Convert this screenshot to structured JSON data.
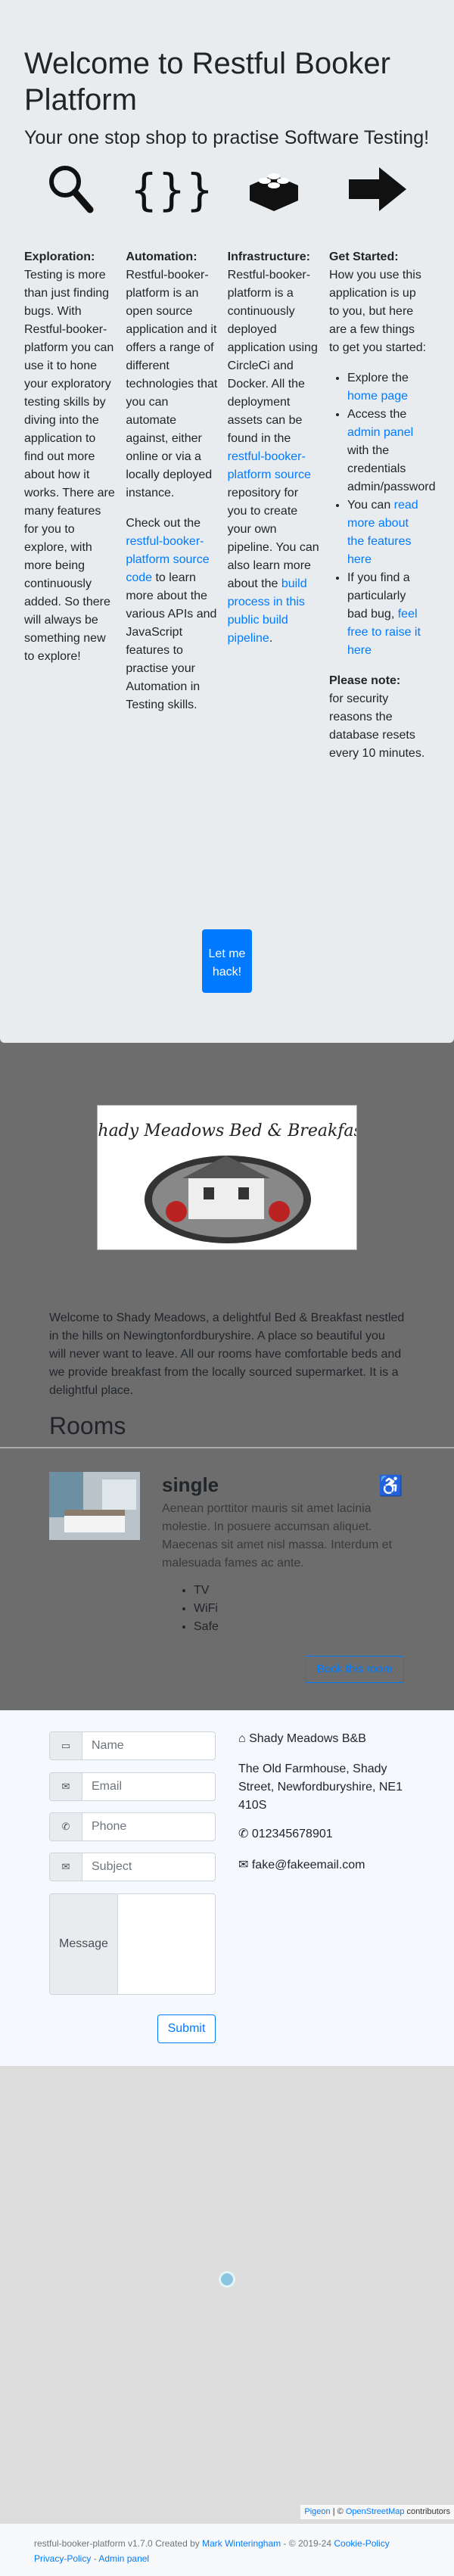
{
  "jumbotron": {
    "title": "Welcome to Restful Booker Platform",
    "lead": "Your one stop shop to practise Software Testing!",
    "exploration": {
      "heading": "Exploration:",
      "text": "Testing is more than just finding bugs. With Restful-booker-platform you can use it to hone your exploratory testing skills by diving into the application to find out more about how it works. There are many features for you to explore, with more being continuously added. So there will always be something new to explore!"
    },
    "automation": {
      "heading": "Automation:",
      "text": "Restful-booker-platform is an open source application and it offers a range of different technologies that you can automate against, either online or via a locally deployed instance.",
      "text2_pre": "Check out the ",
      "link": "restful-booker-platform source code",
      "text2_post": " to learn more about the various APIs and JavaScript features to practise your Automation in Testing skills."
    },
    "infrastructure": {
      "heading": "Infrastructure:",
      "text_pre": "Restful-booker-platform is a continuously deployed application using CircleCi and Docker. All the deployment assets can be found in the ",
      "link1": "restful-booker-platform source",
      "text_mid": " repository for you to create your own pipeline. You can also learn more about the ",
      "link2": "build process in this public build pipeline",
      "text_post": "."
    },
    "started": {
      "heading": "Get Started:",
      "text": "How you use this application is up to you, but here are a few things to get you started:",
      "li1_pre": "Explore the ",
      "li1_link": "home page",
      "li2_pre": "Access the ",
      "li2_link": "admin panel",
      "li2_post": " with the credentials admin/password",
      "li3_pre": "You can ",
      "li3_link": "read more about the features here",
      "li4_pre": "If you find a particularly bad bug, ",
      "li4_link": "feel free to raise it here",
      "note_heading": "Please note:",
      "note_text": "for security reasons the database resets every 10 minutes."
    },
    "hack_button": "Let me hack!"
  },
  "hotel": {
    "logo_text": "Shady Meadows Bed & Breakfast",
    "welcome": "Welcome to Shady Meadows, a delightful Bed & Breakfast nestled in the hills on Newingtonfordburyshire. A place so beautiful you will never want to leave. All our rooms have comfortable beds and we provide breakfast from the locally sourced supermarket. It is a delightful place."
  },
  "rooms": {
    "heading": "Rooms",
    "room": {
      "type": "single",
      "description": "Aenean porttitor mauris sit amet lacinia molestie. In posuere accumsan aliquet. Maecenas sit amet nisl massa. Interdum et malesuada fames ac ante.",
      "features": [
        "TV",
        "WiFi",
        "Safe"
      ],
      "book_button": "Book this room"
    }
  },
  "contact": {
    "name_placeholder": "Name",
    "email_placeholder": "Email",
    "phone_placeholder": "Phone",
    "subject_placeholder": "Subject",
    "message_label": "Message",
    "submit": "Submit",
    "business_name": "Shady Meadows B&B",
    "address": "The Old Farmhouse, Shady Street, Newfordburyshire, NE1 410S",
    "phone": "012345678901",
    "email": "fake@fakeemail.com"
  },
  "map": {
    "attr_pigeon": "Pigeon",
    "attr_sep": " | © ",
    "attr_osm": "OpenStreetMap",
    "attr_post": " contributors"
  },
  "footer": {
    "text_pre": "restful-booker-platform v1.7.0 Created by ",
    "author": "Mark Winteringham",
    "years": " - © 2019-24 ",
    "cookie": "Cookie-Policy",
    "sep1": " - ",
    "privacy": "Privacy-Policy",
    "sep2": " - ",
    "admin": "Admin panel"
  }
}
